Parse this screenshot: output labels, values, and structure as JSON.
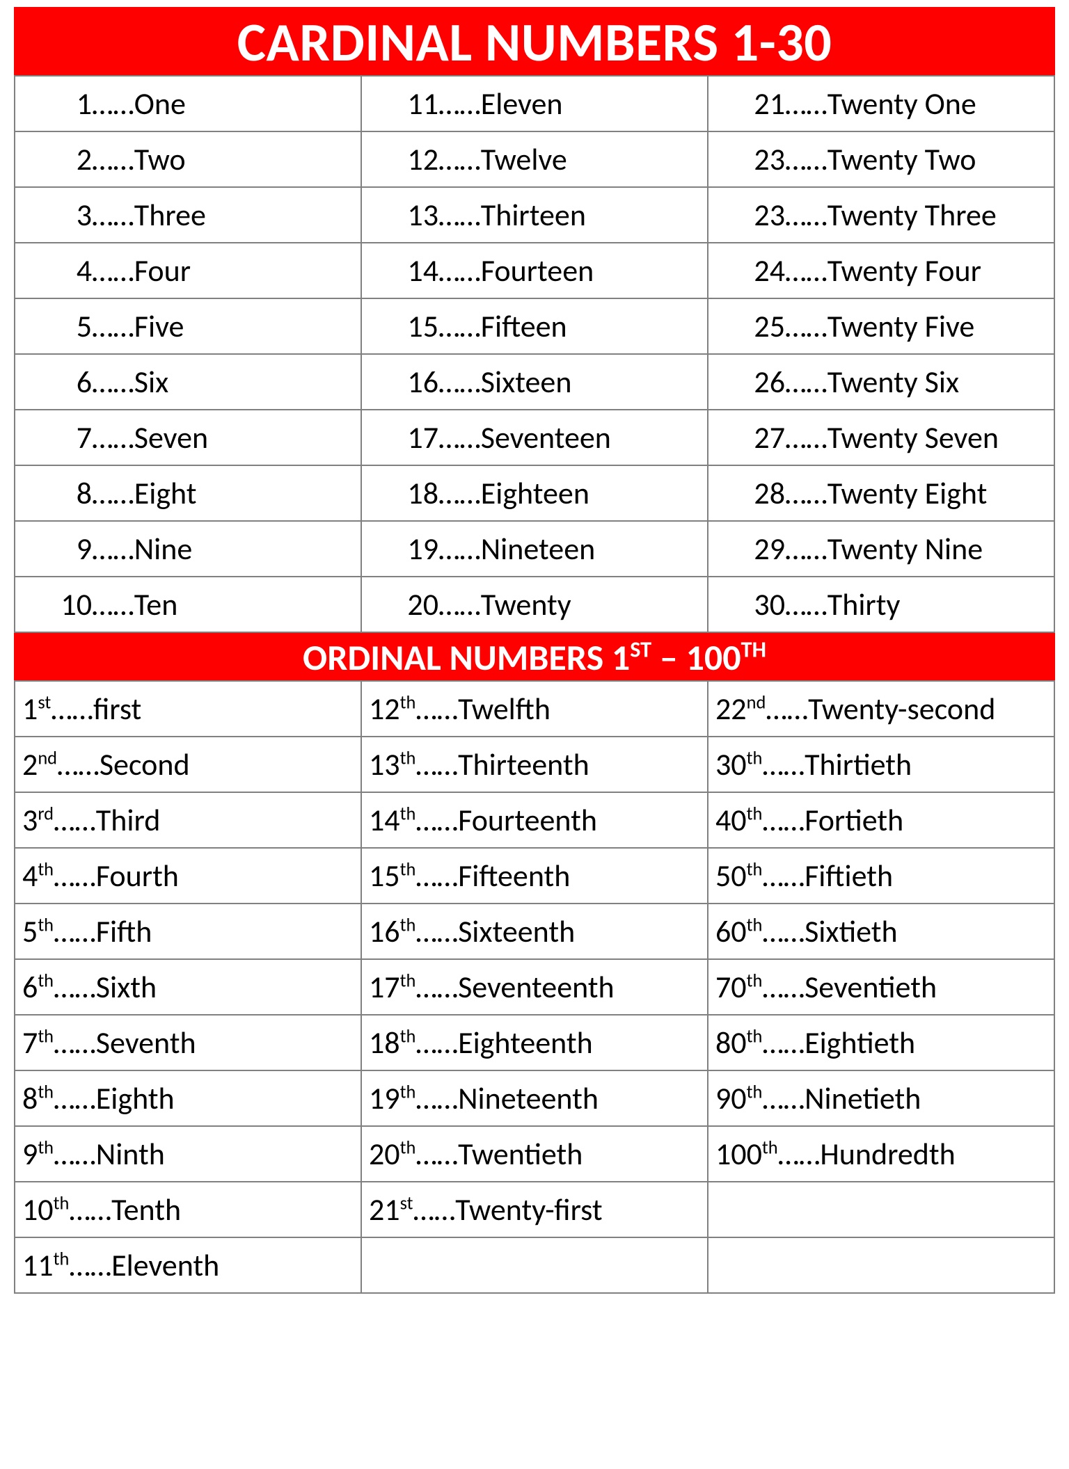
{
  "header1": "CARDINAL NUMBERS 1-30",
  "header2_pre": "ORDINAL NUMBERS 1",
  "header2_sup1": "ST",
  "header2_mid": " – 100",
  "header2_sup2": "TH",
  "dots": "……",
  "cardinal": {
    "col1": [
      {
        "n": "1",
        "w": "One"
      },
      {
        "n": "2",
        "w": "Two"
      },
      {
        "n": "3",
        "w": "Three"
      },
      {
        "n": "4",
        "w": "Four"
      },
      {
        "n": "5",
        "w": "Five"
      },
      {
        "n": "6",
        "w": "Six"
      },
      {
        "n": "7",
        "w": "Seven"
      },
      {
        "n": "8",
        "w": "Eight"
      },
      {
        "n": "9",
        "w": "Nine"
      },
      {
        "n": "10",
        "w": "Ten"
      }
    ],
    "col2": [
      {
        "n": "11",
        "w": "Eleven"
      },
      {
        "n": "12",
        "w": "Twelve"
      },
      {
        "n": "13",
        "w": "Thirteen"
      },
      {
        "n": "14",
        "w": "Fourteen"
      },
      {
        "n": "15",
        "w": "Fifteen"
      },
      {
        "n": "16",
        "w": "Sixteen"
      },
      {
        "n": "17",
        "w": "Seventeen"
      },
      {
        "n": "18",
        "w": "Eighteen"
      },
      {
        "n": "19",
        "w": "Nineteen"
      },
      {
        "n": "20",
        "w": "Twenty"
      }
    ],
    "col3": [
      {
        "n": "21",
        "w": "Twenty One"
      },
      {
        "n": "23",
        "w": "Twenty Two"
      },
      {
        "n": "23",
        "w": "Twenty Three"
      },
      {
        "n": "24",
        "w": "Twenty Four"
      },
      {
        "n": "25",
        "w": "Twenty Five"
      },
      {
        "n": "26",
        "w": "Twenty Six"
      },
      {
        "n": "27",
        "w": "Twenty Seven"
      },
      {
        "n": "28",
        "w": "Twenty Eight"
      },
      {
        "n": "29",
        "w": "Twenty Nine"
      },
      {
        "n": "30",
        "w": "Thirty"
      }
    ]
  },
  "ordinal": {
    "col1": [
      {
        "n": "1",
        "s": "st",
        "w": "first"
      },
      {
        "n": "2",
        "s": "nd",
        "w": "Second"
      },
      {
        "n": "3",
        "s": "rd",
        "w": "Third"
      },
      {
        "n": "4",
        "s": "th",
        "w": "Fourth"
      },
      {
        "n": "5",
        "s": "th",
        "w": "Fifth"
      },
      {
        "n": "6",
        "s": "th",
        "w": "Sixth"
      },
      {
        "n": "7",
        "s": "th",
        "w": "Seventh"
      },
      {
        "n": "8",
        "s": "th",
        "w": "Eighth"
      },
      {
        "n": "9",
        "s": "th",
        "w": "Ninth"
      },
      {
        "n": "10",
        "s": "th",
        "w": "Tenth"
      },
      {
        "n": "11",
        "s": "th",
        "w": "Eleventh"
      }
    ],
    "col2": [
      {
        "n": "12",
        "s": "th",
        "w": "Twelfth"
      },
      {
        "n": "13",
        "s": "th",
        "w": "Thirteenth"
      },
      {
        "n": "14",
        "s": "th",
        "w": "Fourteenth"
      },
      {
        "n": "15",
        "s": "th",
        "w": "Fifteenth"
      },
      {
        "n": "16",
        "s": "th",
        "w": "Sixteenth"
      },
      {
        "n": "17",
        "s": "th",
        "w": "Seventeenth"
      },
      {
        "n": "18",
        "s": "th",
        "w": "Eighteenth"
      },
      {
        "n": "19",
        "s": "th",
        "w": "Nineteenth"
      },
      {
        "n": "20",
        "s": "th",
        "w": "Twentieth"
      },
      {
        "n": "21",
        "s": "st",
        "w": "Twenty-first"
      },
      {
        "empty": true
      }
    ],
    "col3": [
      {
        "n": "22",
        "s": "nd",
        "w": "Twenty-second"
      },
      {
        "n": "30",
        "s": "th",
        "w": "Thirtieth"
      },
      {
        "n": "40",
        "s": "th",
        "w": "Fortieth"
      },
      {
        "n": "50",
        "s": "th",
        "w": "Fiftieth"
      },
      {
        "n": "60",
        "s": "th",
        "w": "Sixtieth"
      },
      {
        "n": "70",
        "s": "th",
        "w": "Seventieth"
      },
      {
        "n": "80",
        "s": "th",
        "w": "Eightieth"
      },
      {
        "n": "90",
        "s": "th",
        "w": "Ninetieth"
      },
      {
        "n": "100",
        "s": "th",
        "w": "Hundredth"
      },
      {
        "empty": true
      },
      {
        "empty": true
      }
    ]
  }
}
